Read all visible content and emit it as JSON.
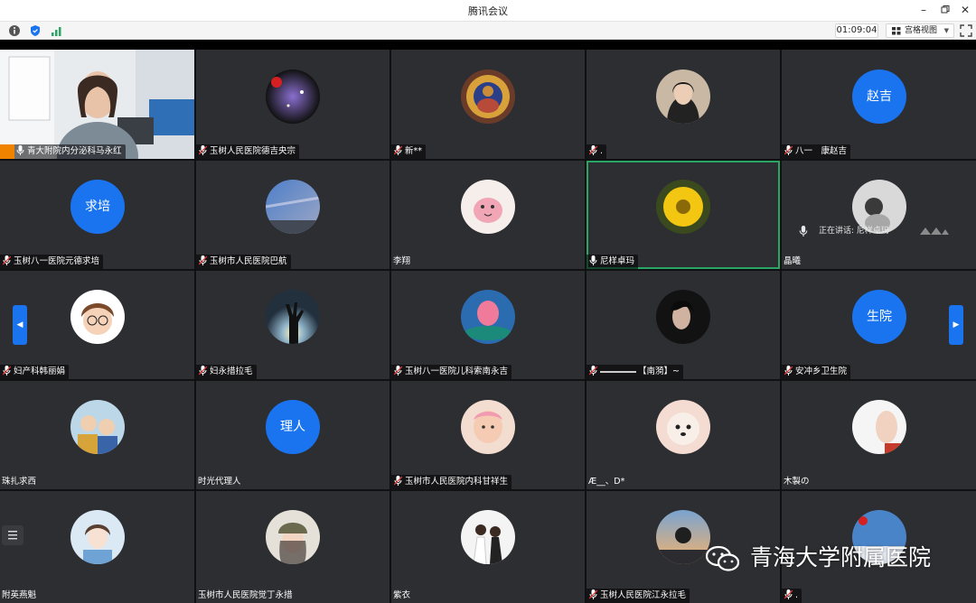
{
  "window": {
    "title": "腾讯会议"
  },
  "toolbar": {
    "timer": "01:09:04",
    "view_label": "宫格视图"
  },
  "speaking_status": "正在讲话: 尼样卓玛",
  "watermark": "青海大学附属医院",
  "colors": {
    "accent": "#1a74ef",
    "speaking_border": "#2aa566",
    "tile_bg": "#2d2e32"
  },
  "participants": [
    {
      "name": "青大附院内分泌科马永红",
      "avatar": "camera-video"
    },
    {
      "name": "玉树人民医院德吉央宗",
      "avatar": "photo-space"
    },
    {
      "name": "新**",
      "avatar": "photo-thangka"
    },
    {
      "name": ".",
      "avatar": "photo-woman"
    },
    {
      "name": "八一　康赵吉",
      "avatar": "text",
      "avatar_text": "赵吉"
    },
    {
      "name": "玉树八一医院元德求培",
      "avatar": "text",
      "avatar_text": "求培"
    },
    {
      "name": "玉树市人民医院巴航",
      "avatar": "photo-galaxy"
    },
    {
      "name": "李翔",
      "avatar": "photo-cartoon"
    },
    {
      "name": "尼样卓玛",
      "avatar": "photo-flower",
      "speaking": true
    },
    {
      "name": "晶曦",
      "avatar": "photo-child"
    },
    {
      "name": "妇产科韩丽娟",
      "avatar": "photo-boy-cartoon"
    },
    {
      "name": "妇永措拉毛",
      "avatar": "photo-hand"
    },
    {
      "name": "玉树八一医院儿科索南永吉",
      "avatar": "photo-lotus"
    },
    {
      "name": "【南漪】~",
      "avatar": "photo-girl-dark"
    },
    {
      "name": "安冲乡卫生院",
      "avatar": "text",
      "avatar_text": "生院"
    },
    {
      "name": "珠扎求西",
      "avatar": "photo-kids"
    },
    {
      "name": "时光代理人",
      "avatar": "text",
      "avatar_text": "理人"
    },
    {
      "name": "玉树市人民医院内科甘祥生",
      "avatar": "photo-baby"
    },
    {
      "name": "Æ__、D*",
      "avatar": "photo-dog"
    },
    {
      "name": "木製の",
      "avatar": "photo-face"
    },
    {
      "name": "附英燕魁",
      "avatar": "photo-illustration"
    },
    {
      "name": "玉树市人民医院觉丁永措",
      "avatar": "photo-cap-girl"
    },
    {
      "name": "紫衣",
      "avatar": "photo-couple"
    },
    {
      "name": "玉树人民医院江永拉毛",
      "avatar": "photo-sunset"
    },
    {
      "name": ".",
      "avatar": "photo-flag"
    }
  ]
}
